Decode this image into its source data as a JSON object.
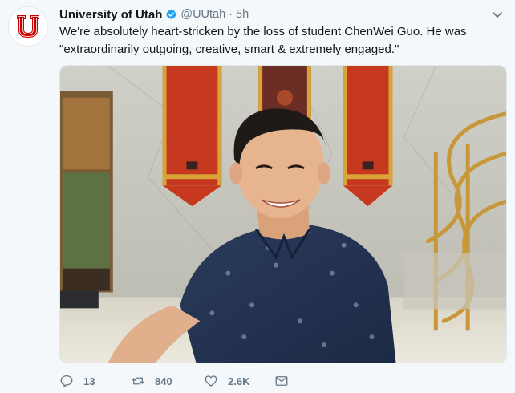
{
  "tweet": {
    "author_name": "University of Utah",
    "handle": "@UUtah",
    "separator": "·",
    "time": "5h",
    "text_line1": "We're absolutely heart-stricken by the loss of student ChenWei Guo. He was",
    "text_line2": "\"extraordinarily outgoing, creative, smart & extremely engaged.\"",
    "avatar_icon": "block-u-logo-icon",
    "verified_icon": "verified-badge-icon",
    "verified_color": "#1da1f2",
    "brand_color": "#cc0000",
    "photo_subject": "student-portrait-photo"
  },
  "actions": {
    "reply_icon": "reply-icon",
    "reply_count": "13",
    "retweet_icon": "retweet-icon",
    "retweet_count": "840",
    "like_icon": "heart-icon",
    "like_count": "2.6K",
    "dm_icon": "envelope-icon"
  },
  "colors": {
    "text": "#14171a",
    "muted": "#657786",
    "background": "#f5f8fa"
  }
}
